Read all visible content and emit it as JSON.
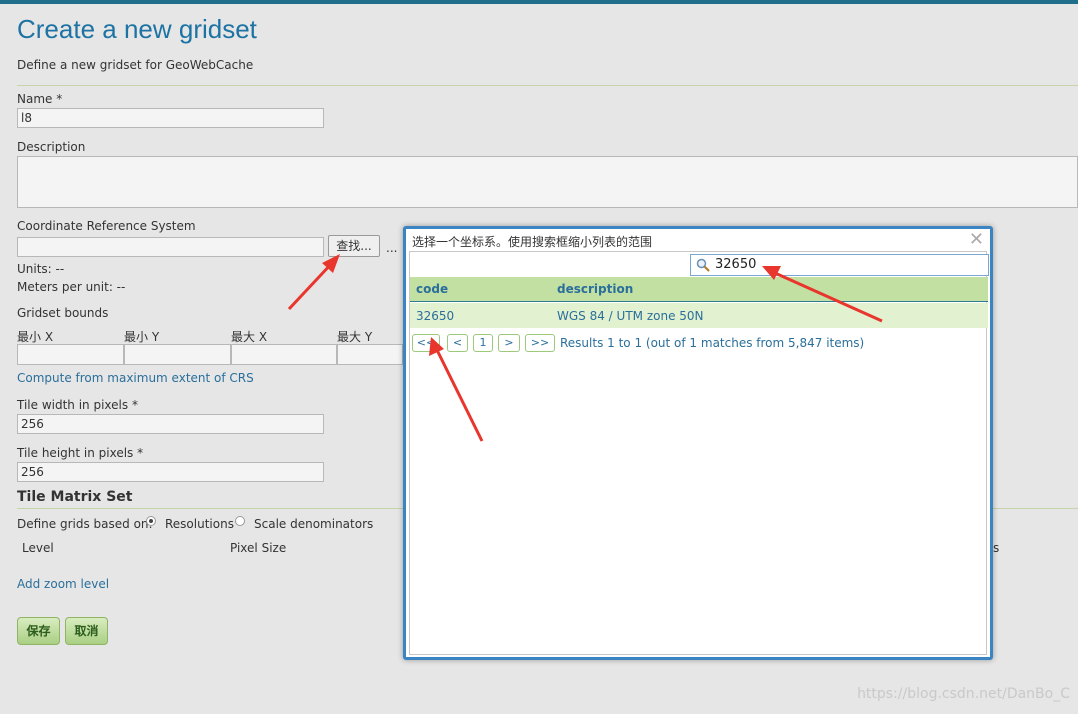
{
  "page": {
    "title": "Create a new gridset",
    "subtitle": "Define a new gridset for GeoWebCache"
  },
  "form": {
    "name_label": "Name *",
    "name_value": "l8",
    "description_label": "Description",
    "crs_label": "Coordinate Reference System",
    "find_button": "查找...",
    "ellipsis": "...",
    "units_label": "Units: --",
    "meters_label": "Meters per unit: --",
    "bounds_label": "Gridset bounds",
    "bounds_cols": [
      "最小 X",
      "最小 Y",
      "最大 X",
      "最大 Y"
    ],
    "compute_link": "Compute from maximum extent of CRS",
    "tile_width_label": "Tile width in pixels *",
    "tile_width_value": "256",
    "tile_height_label": "Tile height in pixels *",
    "tile_height_value": "256"
  },
  "matrix": {
    "heading": "Tile Matrix Set",
    "define_label": "Define grids based on:",
    "option_resolutions": "Resolutions",
    "option_scale": "Scale denominators",
    "selected": "Resolutions",
    "col_level": "Level",
    "col_pixel": "Pixel Size",
    "col_trailing": "s",
    "add_zoom": "Add zoom level"
  },
  "actions": {
    "save": "保存",
    "cancel": "取消"
  },
  "modal": {
    "title": "选择一个坐标系。使用搜索框缩小列表的范围",
    "close_glyph": "✕",
    "search_value": "32650",
    "columns": {
      "code": "code",
      "description": "description"
    },
    "rows": [
      {
        "code": "32650",
        "description": "WGS 84 / UTM zone 50N"
      }
    ],
    "pager": {
      "first": "<<",
      "prev": "<",
      "page": "1",
      "next": ">",
      "last": ">>"
    },
    "results_text": "Results 1 to 1 (out of 1 matches from 5,847 items)"
  },
  "watermark": "https://blog.csdn.net/DanBo_C",
  "colors": {
    "accent_blue": "#1d73a3",
    "header_green": "#c3e0a3",
    "annotation_red": "#e8362d"
  }
}
